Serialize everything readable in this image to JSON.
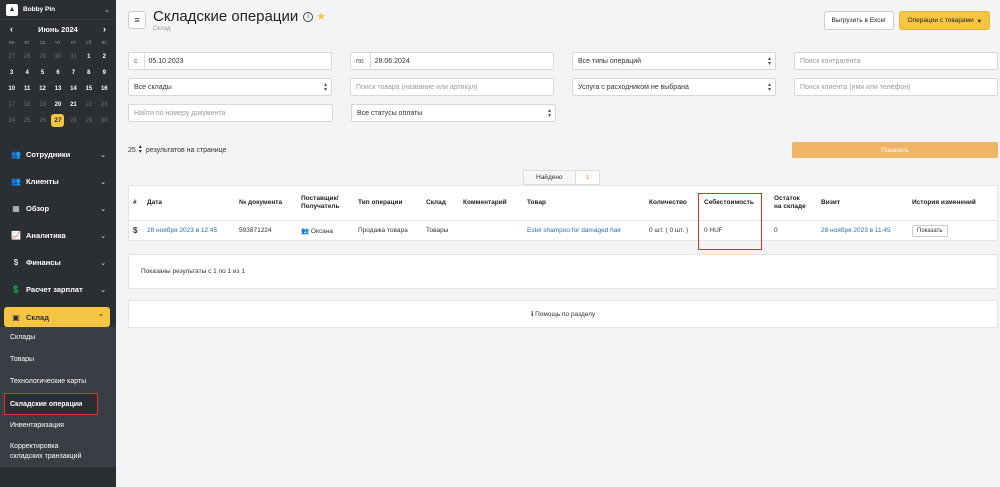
{
  "sidebar": {
    "org_name": "Bobby Pin",
    "calendar": {
      "month_label": "Июнь 2024",
      "dow": [
        "пн",
        "вт",
        "ср",
        "чт",
        "пт",
        "сб",
        "вс"
      ],
      "days": [
        {
          "d": "27",
          "m": true
        },
        {
          "d": "28",
          "m": true
        },
        {
          "d": "29",
          "m": true
        },
        {
          "d": "30",
          "m": true
        },
        {
          "d": "31",
          "m": true
        },
        {
          "d": "1",
          "m": false
        },
        {
          "d": "2",
          "m": false
        },
        {
          "d": "3",
          "m": false
        },
        {
          "d": "4",
          "m": false
        },
        {
          "d": "5",
          "m": false
        },
        {
          "d": "6",
          "m": false
        },
        {
          "d": "7",
          "m": false
        },
        {
          "d": "8",
          "m": false
        },
        {
          "d": "9",
          "m": false
        },
        {
          "d": "10",
          "m": false
        },
        {
          "d": "11",
          "m": false
        },
        {
          "d": "12",
          "m": false
        },
        {
          "d": "13",
          "m": false
        },
        {
          "d": "14",
          "m": false
        },
        {
          "d": "15",
          "m": false
        },
        {
          "d": "16",
          "m": false
        },
        {
          "d": "17",
          "m": true
        },
        {
          "d": "18",
          "m": true
        },
        {
          "d": "19",
          "m": true
        },
        {
          "d": "20",
          "m": false
        },
        {
          "d": "21",
          "m": false
        },
        {
          "d": "22",
          "m": true
        },
        {
          "d": "23",
          "m": true
        },
        {
          "d": "24",
          "m": true
        },
        {
          "d": "25",
          "m": true
        },
        {
          "d": "26",
          "m": true
        },
        {
          "d": "27",
          "m": false,
          "today": true
        },
        {
          "d": "28",
          "m": true
        },
        {
          "d": "29",
          "m": true
        },
        {
          "d": "30",
          "m": true
        }
      ]
    },
    "nav": [
      {
        "label": "Сотрудники",
        "icon": "👥"
      },
      {
        "label": "Клиенты",
        "icon": "👥"
      },
      {
        "label": "Обзор",
        "icon": "▦"
      },
      {
        "label": "Аналитика",
        "icon": "📈"
      },
      {
        "label": "Финансы",
        "icon": "$"
      },
      {
        "label": "Расчет зарплат",
        "icon": "💲"
      }
    ],
    "active": {
      "label": "Склад",
      "icon": "▣"
    },
    "subnav": {
      "item0": "Склады",
      "item1": "Товары",
      "item2": "Технологические карты",
      "item3": "Складские операции",
      "item4": "Инвентаризация",
      "item5_line1": "Корректировка",
      "item5_line2": "складских транзакций"
    }
  },
  "header": {
    "title": "Складские операции",
    "breadcrumb": "Склад",
    "btn_excel": "Выгрузить в Excel",
    "btn_ops": "Операции с товарами"
  },
  "filters": {
    "date_from_prefix": "с",
    "date_from": "05.10.2023",
    "date_to_prefix": "по",
    "date_to": "28.06.2024",
    "op_types": "Все типы операций",
    "counterparty_ph": "Поиск контрагента",
    "warehouses": "Все склады",
    "product_ph": "Поиск товара (название или артикул)",
    "service": "Услуга с расходником не выбрана",
    "client_ph": "Поиск клиента (имя или телефон)",
    "doc_ph": "Найти по номеру документа",
    "payment": "Все статусы оплаты"
  },
  "perpage": {
    "value": "25",
    "label": "результатов на странице"
  },
  "show_btn": "Показать",
  "found": {
    "label": "Найдено",
    "count": "1"
  },
  "table": {
    "headers": {
      "hash": "#",
      "date": "Дата",
      "doc": "№ документа",
      "supplier_1": "Поставщик/",
      "supplier_2": "Получатель",
      "op_type": "Тип операции",
      "warehouse": "Склад",
      "comment": "Комментарий",
      "product": "Товар",
      "qty": "Количество",
      "cost": "Себестоимость",
      "remain_1": "Остаток",
      "remain_2": "на складе",
      "visit": "Визит",
      "history": "История изменений"
    },
    "row": {
      "mark": "$",
      "date": "28 ноября 2023 в 12:45",
      "doc": "593871224",
      "supplier": "Оксана",
      "op_type": "Продажа товара",
      "warehouse": "Товары",
      "comment": "",
      "product": "Estel shampoo for damaged hair",
      "qty": "0 шт. ( 0 шт. )",
      "cost": "0 HUF",
      "remain": "0",
      "visit": "28 ноября 2023 в 11:45",
      "history_btn": "Показать"
    }
  },
  "shown_text": "Показаны результаты с 1 по 1 из 1",
  "help_text": "Помощь по разделу",
  "colors": {
    "accent": "#f5c542",
    "highlight": "#e0322a",
    "link": "#2a6fb5",
    "show_btn": "#f0b466"
  }
}
